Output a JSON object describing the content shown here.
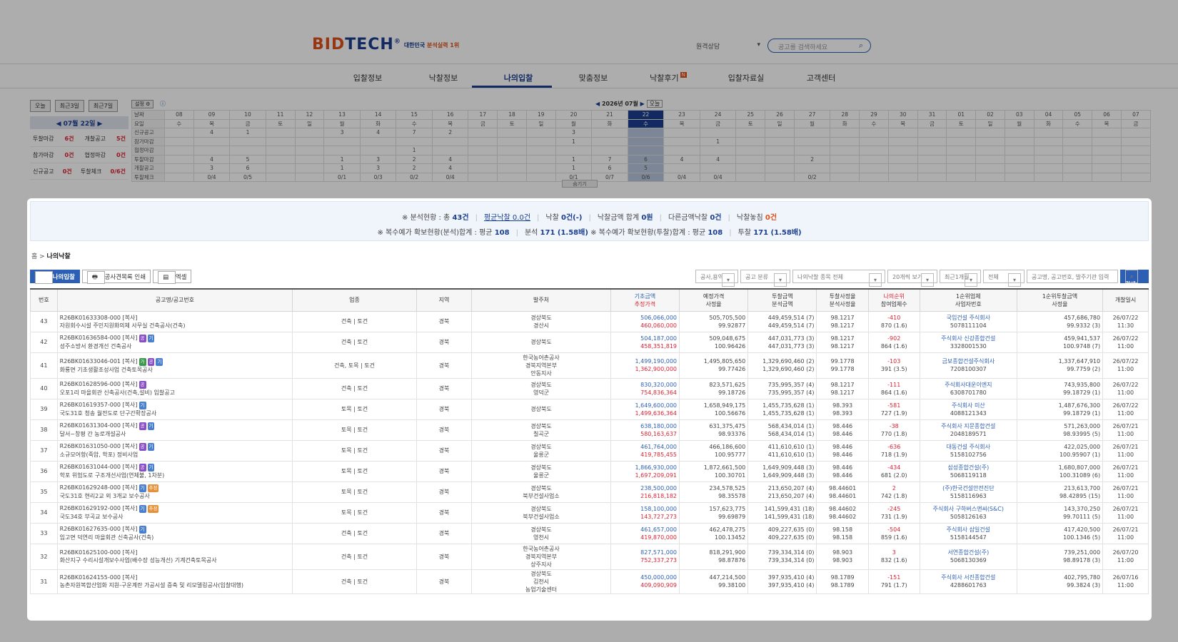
{
  "header": {
    "logo_a": "BID",
    "logo_b": "TECH",
    "logo_reg": "®",
    "logo_tag_a": "대한민국 ",
    "logo_tag_b": "분석실력 1위",
    "select_value": "원격상담",
    "search_placeholder": "공고를 검색하세요"
  },
  "nav": {
    "items": [
      "입찰정보",
      "낙찰정보",
      "나의입찰",
      "맞춤정보",
      "낙찰후기",
      "입찰자료실",
      "고객센터"
    ],
    "new_badge": "N"
  },
  "calendar": {
    "buttons": [
      "오늘",
      "최근3일",
      "최근7일"
    ],
    "setting": "설정",
    "date_label": "07월 22일",
    "month_label": "2026년 07월",
    "today_btn": "오늘",
    "stats": [
      [
        "투찰마감",
        "6건",
        "개찰공고",
        "5건"
      ],
      [
        "참가마감",
        "0건",
        "협정마감",
        "0건"
      ],
      [
        "신규공고",
        "0건",
        "투찰체크",
        "0/6건"
      ]
    ],
    "days": [
      "08",
      "09",
      "10",
      "11",
      "12",
      "13",
      "14",
      "15",
      "16",
      "17",
      "18",
      "19",
      "20",
      "21",
      "22",
      "23",
      "24",
      "25",
      "26",
      "27",
      "28",
      "29",
      "30",
      "31",
      "01",
      "02",
      "03",
      "04",
      "05",
      "06",
      "07"
    ],
    "weekdays": [
      "수",
      "목",
      "금",
      "토",
      "일",
      "월",
      "화",
      "수",
      "목",
      "금",
      "토",
      "일",
      "월",
      "화",
      "수",
      "목",
      "금",
      "토",
      "일",
      "월",
      "화",
      "수",
      "목",
      "금",
      "토",
      "일",
      "월",
      "화",
      "수",
      "목",
      "금"
    ],
    "rows": [
      {
        "label": "신규공고",
        "cells": [
          "",
          "4",
          "1",
          "",
          "",
          "3",
          "4",
          "7",
          "2",
          "",
          "",
          "",
          "3",
          "",
          "",
          "",
          "",
          "",
          "",
          "",
          "",
          "",
          "",
          "",
          "",
          "",
          "",
          "",
          "",
          "",
          ""
        ]
      },
      {
        "label": "참가마감",
        "cells": [
          "",
          "",
          "",
          "",
          "",
          "",
          "",
          "",
          "",
          "",
          "",
          "",
          "1",
          "",
          "",
          "",
          "1",
          "",
          "",
          "",
          "",
          "",
          "",
          "",
          "",
          "",
          "",
          "",
          "",
          "",
          ""
        ]
      },
      {
        "label": "협정마감",
        "cells": [
          "",
          "",
          "",
          "",
          "",
          "",
          "",
          "1",
          "",
          "",
          "",
          "",
          "",
          "",
          "",
          "",
          "",
          "",
          "",
          "",
          "",
          "",
          "",
          "",
          "",
          "",
          "",
          "",
          "",
          "",
          ""
        ]
      },
      {
        "label": "투찰마감",
        "cells": [
          "",
          "4",
          "5",
          "",
          "",
          "1",
          "3",
          "2",
          "4",
          "",
          "",
          "",
          "1",
          "7",
          "6",
          "4",
          "4",
          "",
          "",
          "2",
          "",
          "",
          "",
          "",
          "",
          "",
          "",
          "",
          "",
          "",
          ""
        ]
      },
      {
        "label": "개찰공고",
        "cells": [
          "",
          "3",
          "6",
          "",
          "",
          "1",
          "3",
          "2",
          "4",
          "",
          "",
          "",
          "1",
          "6",
          "5",
          "",
          "",
          "",
          "",
          "",
          "",
          "",
          "",
          "",
          "",
          "",
          "",
          "",
          "",
          "",
          ""
        ]
      },
      {
        "label": "투찰체크",
        "cells": [
          "",
          "0/4",
          "0/5",
          "",
          "",
          "0/1",
          "0/3",
          "0/2",
          "0/4",
          "",
          "",
          "",
          "0/1",
          "0/7",
          "0/6",
          "0/4",
          "0/4",
          "",
          "",
          "0/2",
          "",
          "",
          "",
          "",
          "",
          "",
          "",
          "",
          "",
          "",
          ""
        ]
      }
    ],
    "day_row_label": "날짜",
    "weekday_row_label": "요일",
    "fold": "숨기기"
  },
  "summary": {
    "line1": [
      {
        "t": "※ 분석현황 : 총 ",
        "v": "43건"
      },
      {
        "t": "평균낙찰 ",
        "v": "0.0건",
        "link": true
      },
      {
        "t": "낙찰 ",
        "v": "0건(-)"
      },
      {
        "t": "낙찰금액 합계 ",
        "v": "0원"
      },
      {
        "t": "다른금액낙찰 ",
        "v": "0건"
      },
      {
        "t": "낙찰놓침 ",
        "v": "0건",
        "red": true
      }
    ],
    "line2": [
      {
        "t": "※ 복수예가 확보현황(분석)합계 : 평균 ",
        "v": "108"
      },
      {
        "t": "분석 ",
        "v": "171 (1.58배)"
      },
      {
        "t": "※ 복수예가 확보현황(투찰)합계 : 평균 ",
        "v": "108",
        "nosep": true
      },
      {
        "t": "투찰 ",
        "v": "171 (1.58배)"
      }
    ]
  },
  "breadcrumb": {
    "home": "홈",
    "current": "나의낙찰"
  },
  "tools": [
    "나의입찰",
    "공사견목록 인쇄",
    "엑셀"
  ],
  "filters": [
    "공사,용역",
    "공고 분류",
    "나의낙찰 종목 전체",
    "20개씩 보기",
    "최근1개월",
    "전체",
    "공고명, 공고번호, 발주기관 입력",
    "검색"
  ],
  "table": {
    "headers": [
      [
        "번호"
      ],
      [
        "공고명/공고번호"
      ],
      [
        "업종"
      ],
      [
        "지역"
      ],
      [
        "발주처"
      ],
      [
        "기초금액",
        "추정가격"
      ],
      [
        "예정가격",
        "사정율"
      ],
      [
        "투찰금액",
        "분석금액"
      ],
      [
        "투찰사정율",
        "분석사정율"
      ],
      [
        "나의순위",
        "참여업체수"
      ],
      [
        "1순위업체",
        "사업자번호"
      ],
      [
        "1순위투찰금액",
        "사정율"
      ],
      [
        "개찰일시"
      ]
    ],
    "rows": [
      {
        "no": "43",
        "id": "R26BK01633308-000 [복사]",
        "badges": [],
        "name": "자원회수시설 주민지원화의체 사무실 건축공사(건축)",
        "ind": "건축 | 토건",
        "reg": "경북",
        "org": [
          "경상북도",
          "경산시"
        ],
        "base": "506,066,000",
        "est": "460,060,000",
        "pre": "505,705,500",
        "pre2": "99.92877",
        "bid": "449,459,514 (7)",
        "bid2": "449,459,514 (7)",
        "rt": "98.1217",
        "rt2": "98.1217",
        "rank": "-410",
        "cnt": "870 (1.6)",
        "rank_red": true,
        "win": "국임건설 주식회사",
        "biz": "5078111104",
        "wamt": "457,686,780",
        "wr": "99.9332 (3)",
        "dt": "26/07/22",
        "tm": "11:30"
      },
      {
        "no": "42",
        "id": "R26BK01636584-000 [복사]",
        "badges": [
          "p",
          "b"
        ],
        "name": "성주소방서 환경개선 건축공사",
        "ind": "건축 | 토건",
        "reg": "경북",
        "org": [
          "경상북도"
        ],
        "base": "504,187,000",
        "est": "458,351,819",
        "pre": "509,048,675",
        "pre2": "100.96426",
        "bid": "447,031,773 (3)",
        "bid2": "447,031,773 (3)",
        "rt": "98.1217",
        "rt2": "98.1217",
        "rank": "-902",
        "cnt": "864 (1.6)",
        "rank_red": true,
        "win": "주식회사 신강종합건설",
        "biz": "3328001530",
        "wamt": "459,941,537",
        "wr": "100.9748 (7)",
        "dt": "26/07/22",
        "tm": "11:00"
      },
      {
        "no": "41",
        "id": "R26BK01633046-001 [복사]",
        "badges": [
          "g",
          "p",
          "b"
        ],
        "name": "화룡면 기초생활조성사업 건축토목공사",
        "ind": "건축, 토목 | 토건",
        "reg": "경북",
        "org": [
          "한국농어촌공사",
          "경북지역본부",
          "안동지사"
        ],
        "base": "1,499,190,000",
        "est": "1,362,900,000",
        "pre": "1,495,805,650",
        "pre2": "99.77426",
        "bid": "1,329,690,460 (2)",
        "bid2": "1,329,690,460 (2)",
        "rt": "99.1778",
        "rt2": "99.1778",
        "rank": "-103",
        "cnt": "391 (3.5)",
        "rank_red": true,
        "win": "금보종합건설주식회사",
        "biz": "7208100307",
        "wamt": "1,337,647,910",
        "wr": "99.7759 (2)",
        "dt": "26/07/22",
        "tm": "11:00"
      },
      {
        "no": "40",
        "id": "R26BK01628596-000 [복사]",
        "badges": [
          "p"
        ],
        "name": "오포1리 마을회관 신축공사(건축,설비) 입찰공고",
        "ind": "건축 | 토건",
        "reg": "경북",
        "org": [
          "경상북도",
          "영덕군"
        ],
        "base": "830,320,000",
        "est": "754,836,364",
        "pre": "823,571,625",
        "pre2": "99.18726",
        "bid": "735,995,357 (4)",
        "bid2": "735,995,357 (4)",
        "rt": "98.1217",
        "rt2": "98.1217",
        "rank": "-111",
        "cnt": "864 (1.6)",
        "rank_red": true,
        "win": "주식회사대운이엔지",
        "biz": "6308701780",
        "wamt": "743,935,800",
        "wr": "99.18729 (1)",
        "dt": "26/07/22",
        "tm": "11:00"
      },
      {
        "no": "39",
        "id": "R26BK01619357-000 [복사]",
        "badges": [
          "b"
        ],
        "name": "국도31호 청송 월전도로 단구간확장공사",
        "ind": "토목 | 토건",
        "reg": "경북",
        "org": [
          "경상북도"
        ],
        "base": "1,649,600,000",
        "est": "1,499,636,364",
        "pre": "1,658,949,175",
        "pre2": "100.56676",
        "bid": "1,455,735,628 (1)",
        "bid2": "1,455,735,628 (1)",
        "rt": "98.393",
        "rt2": "98.393",
        "rank": "-581",
        "cnt": "727 (1.9)",
        "rank_red": true,
        "win": "주식회사 미산",
        "biz": "4088121343",
        "wamt": "1,487,676,300",
        "wr": "99.18729 (1)",
        "dt": "26/07/22",
        "tm": "11:00"
      },
      {
        "no": "38",
        "id": "R26BK01631304-000 [복사]",
        "badges": [
          "p",
          "b"
        ],
        "name": "달서~창평 간 농로개설공사",
        "ind": "토목 | 토건",
        "reg": "경북",
        "org": [
          "경상북도",
          "칠곡군"
        ],
        "base": "638,180,000",
        "est": "580,163,637",
        "pre": "631,375,475",
        "pre2": "98.93376",
        "bid": "568,434,014 (1)",
        "bid2": "568,434,014 (1)",
        "rt": "98.446",
        "rt2": "98.446",
        "rank": "-38",
        "cnt": "770 (1.8)",
        "rank_red": true,
        "win": "주식회사 지문종합건설",
        "biz": "2048189571",
        "wamt": "571,263,000",
        "wr": "98.93995 (5)",
        "dt": "26/07/21",
        "tm": "11:00"
      },
      {
        "no": "37",
        "id": "R26BK01631050-000 [복사]",
        "badges": [
          "p",
          "b"
        ],
        "name": "소규모어항(죽암, 학포) 정비사업",
        "ind": "토목 | 토건",
        "reg": "경북",
        "org": [
          "경상북도",
          "울릉군"
        ],
        "base": "461,764,000",
        "est": "419,785,455",
        "pre": "466,186,600",
        "pre2": "100.95777",
        "bid": "411,610,610 (1)",
        "bid2": "411,610,610 (1)",
        "rt": "98.446",
        "rt2": "98.446",
        "rank": "-636",
        "cnt": "718 (1.9)",
        "rank_red": true,
        "win": "대동건설 주식회사",
        "biz": "5158102756",
        "wamt": "422,025,000",
        "wr": "100.95907 (1)",
        "dt": "26/07/21",
        "tm": "11:00"
      },
      {
        "no": "36",
        "id": "R26BK01631044-000 [복사]",
        "badges": [
          "p",
          "b"
        ],
        "name": "학포 위험도로 구조개선사업(연체불, 1차분)",
        "ind": "토목 | 토건",
        "reg": "경북",
        "org": [
          "경상북도",
          "울릉군"
        ],
        "base": "1,866,930,000",
        "est": "1,697,209,091",
        "pre": "1,872,661,500",
        "pre2": "100.30701",
        "bid": "1,649,909,448 (3)",
        "bid2": "1,649,909,448 (3)",
        "rt": "98.446",
        "rt2": "98.446",
        "rank": "-434",
        "cnt": "681 (2.0)",
        "rank_red": true,
        "win": "삼성종합건설(주)",
        "biz": "5068119118",
        "wamt": "1,680,807,000",
        "wr": "100.31089 (6)",
        "dt": "26/07/21",
        "tm": "11:00"
      },
      {
        "no": "35",
        "id": "R26BK01629248-000 [복사]",
        "badges": [
          "b",
          "o"
        ],
        "name": "국도31호 현리2교 외 3개교 보수공사",
        "ind": "토목 | 토건",
        "reg": "경북",
        "org": [
          "경상북도",
          "북부건설사업소"
        ],
        "base": "238,500,000",
        "est": "216,818,182",
        "pre": "234,578,525",
        "pre2": "98.35578",
        "bid": "213,650,207 (4)",
        "bid2": "213,650,207 (4)",
        "rt": "98.44601",
        "rt2": "98.44601",
        "rank": "2",
        "cnt": "742 (1.8)",
        "rank_red": true,
        "win": "(주)한국건설안전진단",
        "biz": "5158116963",
        "wamt": "213,613,700",
        "wr": "98.42895 (15)",
        "dt": "26/07/21",
        "tm": "11:00"
      },
      {
        "no": "34",
        "id": "R26BK01629192-000 [복사]",
        "badges": [
          "b",
          "o"
        ],
        "name": "국도34호 부곡교 보수공사",
        "ind": "토목 | 토건",
        "reg": "경북",
        "org": [
          "경상북도",
          "북부건설사업소"
        ],
        "base": "158,100,000",
        "est": "143,727,273",
        "pre": "157,623,775",
        "pre2": "99.69879",
        "bid": "141,599,431 (18)",
        "bid2": "141,599,431 (18)",
        "rt": "98.44602",
        "rt2": "98.44602",
        "rank": "-245",
        "cnt": "731 (1.9)",
        "rank_red": true,
        "win": "주식회사 구하버스앤씨(S&C)",
        "biz": "5058126163",
        "wamt": "143,370,250",
        "wr": "99.70111 (5)",
        "dt": "26/07/21",
        "tm": "11:00"
      },
      {
        "no": "33",
        "id": "R26BK01627635-000 [복사]",
        "badges": [
          "b"
        ],
        "name": "임고면 덕연리 마을회관 신축공사(건축)",
        "ind": "건축 | 토건",
        "reg": "경북",
        "org": [
          "경상북도",
          "영천시"
        ],
        "base": "461,657,000",
        "est": "419,870,000",
        "pre": "462,478,275",
        "pre2": "100.13452",
        "bid": "409,227,635 (0)",
        "bid2": "409,227,635 (0)",
        "rt": "98.158",
        "rt2": "98.158",
        "rank": "-504",
        "cnt": "859 (1.6)",
        "rank_red": true,
        "win": "주식회사 삼일건설",
        "biz": "5158144547",
        "wamt": "417,420,500",
        "wr": "100.1346 (5)",
        "dt": "26/07/21",
        "tm": "11:00"
      },
      {
        "no": "32",
        "id": "R26BK01625100-000 [복사]",
        "badges": [],
        "name": "화산지구 수리시설개보수사업(배수장 성능개선) 기계건축토목공사",
        "ind": "건축 | 토건",
        "reg": "경북",
        "org": [
          "한국농어촌공사",
          "경북지역본부",
          "상주지사"
        ],
        "base": "827,571,000",
        "est": "752,337,273",
        "pre": "818,291,900",
        "pre2": "98.87876",
        "bid": "739,334,314 (0)",
        "bid2": "739,334,314 (0)",
        "rt": "98.903",
        "rt2": "98.903",
        "rank": "3",
        "cnt": "832 (1.6)",
        "rank_red": true,
        "win": "서연종합건설(주)",
        "biz": "5068130369",
        "wamt": "739,251,000",
        "wr": "98.89178 (3)",
        "dt": "26/07/20",
        "tm": "11:00"
      },
      {
        "no": "31",
        "id": "R26BK01624155-000 [복사]",
        "badges": [],
        "name": "농촌자원복합산업화 지원-구운계란 가공시설 증축 및 리모델링공사(입찰대행)",
        "ind": "건축 | 토건",
        "reg": "경북",
        "org": [
          "경상북도",
          "김천시",
          "농업기술센터"
        ],
        "base": "450,000,000",
        "est": "409,090,909",
        "pre": "447,214,500",
        "pre2": "99.38100",
        "bid": "397,935,410 (4)",
        "bid2": "397,935,410 (4)",
        "rt": "98.1789",
        "rt2": "98.1789",
        "rank": "-151",
        "cnt": "791 (1.7)",
        "rank_red": true,
        "win": "주식회사 서진종합건설",
        "biz": "4288601763",
        "wamt": "402,795,780",
        "wr": "99.3824 (3)",
        "dt": "26/07/16",
        "tm": "11:00"
      }
    ]
  }
}
